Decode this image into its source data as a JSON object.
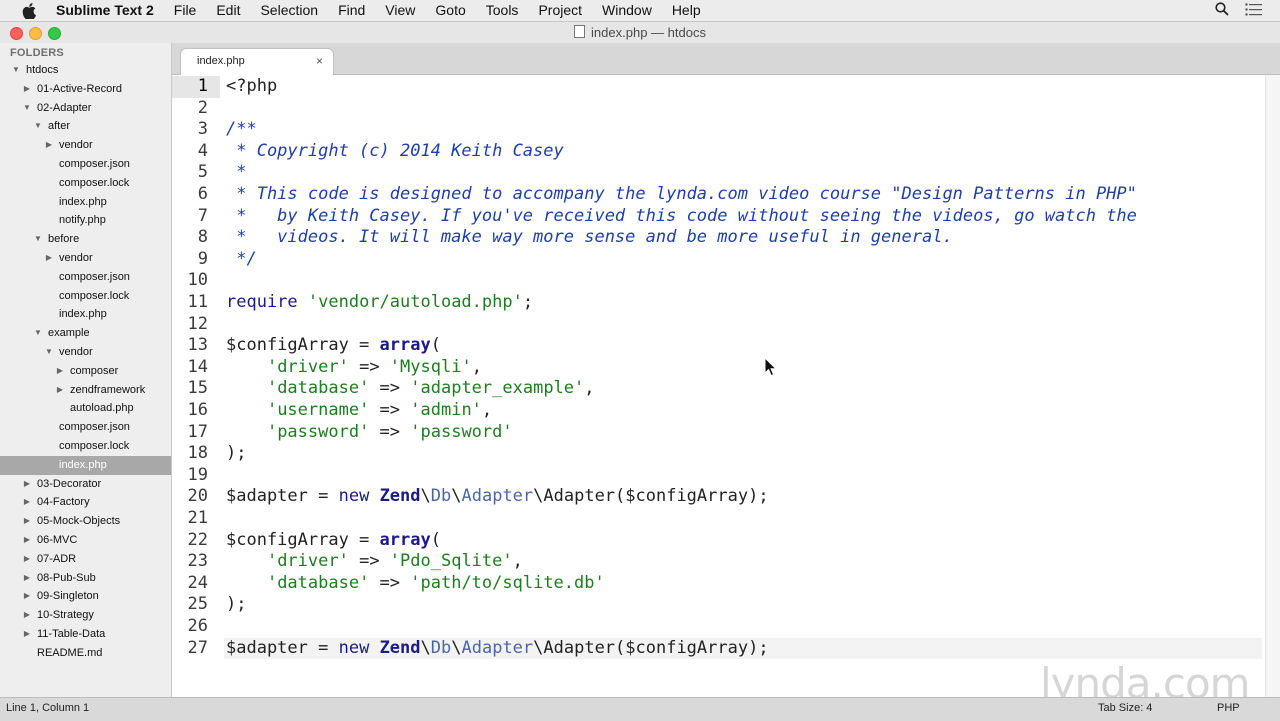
{
  "menubar": {
    "app": "Sublime Text 2",
    "items": [
      "File",
      "Edit",
      "Selection",
      "Find",
      "View",
      "Goto",
      "Tools",
      "Project",
      "Window",
      "Help"
    ]
  },
  "window": {
    "title": "index.php — htdocs"
  },
  "sidebar": {
    "header": "FOLDERS",
    "tree": [
      {
        "label": "htdocs",
        "depth": 0,
        "arrow": "open"
      },
      {
        "label": "01-Active-Record",
        "depth": 1,
        "arrow": "closed"
      },
      {
        "label": "02-Adapter",
        "depth": 1,
        "arrow": "open"
      },
      {
        "label": "after",
        "depth": 2,
        "arrow": "open"
      },
      {
        "label": "vendor",
        "depth": 3,
        "arrow": "closed"
      },
      {
        "label": "composer.json",
        "depth": 3,
        "arrow": "none"
      },
      {
        "label": "composer.lock",
        "depth": 3,
        "arrow": "none"
      },
      {
        "label": "index.php",
        "depth": 3,
        "arrow": "none"
      },
      {
        "label": "notify.php",
        "depth": 3,
        "arrow": "none"
      },
      {
        "label": "before",
        "depth": 2,
        "arrow": "open"
      },
      {
        "label": "vendor",
        "depth": 3,
        "arrow": "closed"
      },
      {
        "label": "composer.json",
        "depth": 3,
        "arrow": "none"
      },
      {
        "label": "composer.lock",
        "depth": 3,
        "arrow": "none"
      },
      {
        "label": "index.php",
        "depth": 3,
        "arrow": "none"
      },
      {
        "label": "example",
        "depth": 2,
        "arrow": "open"
      },
      {
        "label": "vendor",
        "depth": 3,
        "arrow": "open"
      },
      {
        "label": "composer",
        "depth": 4,
        "arrow": "closed"
      },
      {
        "label": "zendframework",
        "depth": 4,
        "arrow": "closed"
      },
      {
        "label": "autoload.php",
        "depth": 4,
        "arrow": "none"
      },
      {
        "label": "composer.json",
        "depth": 3,
        "arrow": "none"
      },
      {
        "label": "composer.lock",
        "depth": 3,
        "arrow": "none"
      },
      {
        "label": "index.php",
        "depth": 3,
        "arrow": "none",
        "selected": true
      },
      {
        "label": "03-Decorator",
        "depth": 1,
        "arrow": "closed"
      },
      {
        "label": "04-Factory",
        "depth": 1,
        "arrow": "closed"
      },
      {
        "label": "05-Mock-Objects",
        "depth": 1,
        "arrow": "closed"
      },
      {
        "label": "06-MVC",
        "depth": 1,
        "arrow": "closed"
      },
      {
        "label": "07-ADR",
        "depth": 1,
        "arrow": "closed"
      },
      {
        "label": "08-Pub-Sub",
        "depth": 1,
        "arrow": "closed"
      },
      {
        "label": "09-Singleton",
        "depth": 1,
        "arrow": "closed"
      },
      {
        "label": "10-Strategy",
        "depth": 1,
        "arrow": "closed"
      },
      {
        "label": "11-Table-Data",
        "depth": 1,
        "arrow": "closed"
      },
      {
        "label": "README.md",
        "depth": 1,
        "arrow": "none"
      }
    ]
  },
  "tab": {
    "label": "index.php",
    "close": "×"
  },
  "editor": {
    "lines": [
      [
        [
          "<?php",
          "plain"
        ]
      ],
      [],
      [
        [
          "/**",
          "cm"
        ]
      ],
      [
        [
          " * Copyright (c) 2014 Keith Casey",
          "cm"
        ]
      ],
      [
        [
          " *",
          "cm"
        ]
      ],
      [
        [
          " * This code is designed to accompany the lynda.com video course \"Design Patterns in PHP\"",
          "cm"
        ]
      ],
      [
        [
          " *   by Keith Casey. If you've received this code without seeing the videos, go watch the",
          "cm"
        ]
      ],
      [
        [
          " *   videos. It will make way more sense and be more useful in general.",
          "cm"
        ]
      ],
      [
        [
          " */",
          "cm"
        ]
      ],
      [],
      [
        [
          "require",
          "kw"
        ],
        [
          " ",
          "plain"
        ],
        [
          "'vendor/autoload.php'",
          "str"
        ],
        [
          ";",
          "plain"
        ]
      ],
      [],
      [
        [
          "$configArray = ",
          "plain"
        ],
        [
          "array",
          "fn"
        ],
        [
          "(",
          "plain"
        ]
      ],
      [
        [
          "    ",
          "plain"
        ],
        [
          "'driver'",
          "str"
        ],
        [
          " => ",
          "plain"
        ],
        [
          "'Mysqli'",
          "str"
        ],
        [
          ",",
          "plain"
        ]
      ],
      [
        [
          "    ",
          "plain"
        ],
        [
          "'database'",
          "str"
        ],
        [
          " => ",
          "plain"
        ],
        [
          "'adapter_example'",
          "str"
        ],
        [
          ",",
          "plain"
        ]
      ],
      [
        [
          "    ",
          "plain"
        ],
        [
          "'username'",
          "str"
        ],
        [
          " => ",
          "plain"
        ],
        [
          "'admin'",
          "str"
        ],
        [
          ",",
          "plain"
        ]
      ],
      [
        [
          "    ",
          "plain"
        ],
        [
          "'password'",
          "str"
        ],
        [
          " => ",
          "plain"
        ],
        [
          "'password'",
          "str"
        ]
      ],
      [
        [
          ");",
          "plain"
        ]
      ],
      [],
      [
        [
          "$adapter = ",
          "plain"
        ],
        [
          "new",
          "kw"
        ],
        [
          " ",
          "plain"
        ],
        [
          "Zend",
          "fn"
        ],
        [
          "\\",
          "plain"
        ],
        [
          "Db",
          "cls"
        ],
        [
          "\\",
          "plain"
        ],
        [
          "Adapter",
          "cls"
        ],
        [
          "\\Adapter($configArray);",
          "plain"
        ]
      ],
      [],
      [
        [
          "$configArray = ",
          "plain"
        ],
        [
          "array",
          "fn"
        ],
        [
          "(",
          "plain"
        ]
      ],
      [
        [
          "    ",
          "plain"
        ],
        [
          "'driver'",
          "str"
        ],
        [
          " => ",
          "plain"
        ],
        [
          "'Pdo_Sqlite'",
          "str"
        ],
        [
          ",",
          "plain"
        ]
      ],
      [
        [
          "    ",
          "plain"
        ],
        [
          "'database'",
          "str"
        ],
        [
          " => ",
          "plain"
        ],
        [
          "'path/to/sqlite.db'",
          "str"
        ]
      ],
      [
        [
          ");",
          "plain"
        ]
      ],
      [],
      [
        [
          "$adapter = ",
          "plain"
        ],
        [
          "new",
          "kw"
        ],
        [
          " ",
          "plain"
        ],
        [
          "Zend",
          "fn"
        ],
        [
          "\\",
          "plain"
        ],
        [
          "Db",
          "cls"
        ],
        [
          "\\",
          "plain"
        ],
        [
          "Adapter",
          "cls"
        ],
        [
          "\\Adapter($configArray);",
          "plain"
        ]
      ]
    ]
  },
  "watermark": {
    "text": "lynda.com"
  },
  "statusbar": {
    "position": "Line 1, Column 1",
    "tab_size": "Tab Size: 4",
    "syntax": "PHP"
  },
  "icons": {
    "apple": "apple-logo-icon",
    "search": "spotlight-search-icon",
    "list": "notification-list-icon",
    "file": "document-icon",
    "pointer": "mouse-pointer-icon"
  }
}
